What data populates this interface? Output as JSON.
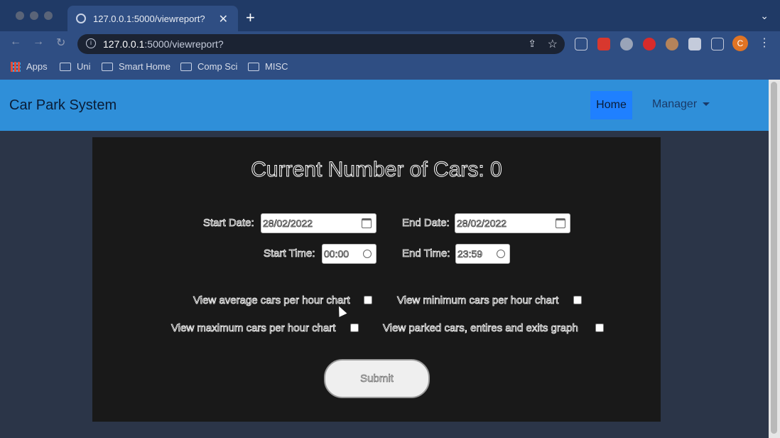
{
  "browser": {
    "tab_title": "127.0.0.1:5000/viewreport?",
    "new_tab_label": "+",
    "url_host": "127.0.0.1",
    "url_rest": ":5000/viewreport?",
    "profile_initial": "C",
    "bookmarks": [
      "Apps",
      "Uni",
      "Smart Home",
      "Comp Sci",
      "MISC"
    ]
  },
  "navbar": {
    "brand": "Car Park System",
    "home": "Home",
    "manager": "Manager"
  },
  "report": {
    "headline": "Current Number of Cars: 0",
    "start_date_label": "Start Date:",
    "start_date_value": "28/02/2022",
    "end_date_label": "End Date:",
    "end_date_value": "28/02/2022",
    "start_time_label": "Start Time:",
    "start_time_value": "00:00",
    "end_time_label": "End Time:",
    "end_time_value": "23:59",
    "opt_average": "View average cars per hour chart",
    "opt_minimum": "View minimum cars per hour chart",
    "opt_maximum": "View maximum cars per hour chart",
    "opt_parked": "View parked cars, entires and exits graph",
    "submit": "Submit"
  },
  "colors": {
    "navbar": "#2f8fd9",
    "home_active": "#1f80ff",
    "panel": "#191919"
  }
}
